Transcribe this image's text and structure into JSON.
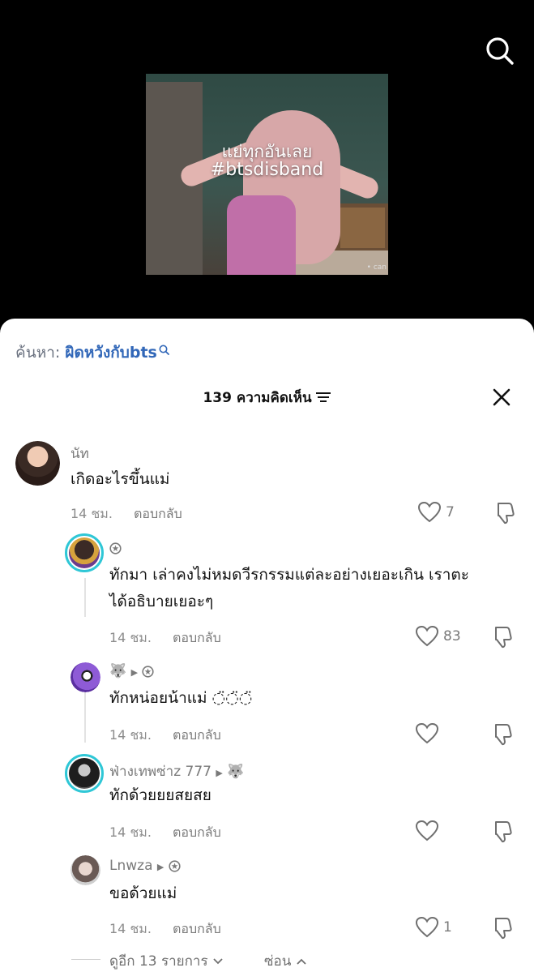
{
  "video": {
    "caption_line1": "แย่ทุกอันเลย",
    "caption_line2": "#btsdisband",
    "watermark": "• can"
  },
  "search_suggestion": {
    "prefix": "ค้นหา:",
    "query": "ผิดหวังกับbts"
  },
  "comments_header": {
    "title": "139 ความคิดเห็น"
  },
  "comments": [
    {
      "username": "นัท",
      "text": "เกิดอะไรขึ้นแม่",
      "time": "14 ชม.",
      "reply_label": "ตอบกลับ",
      "likes": "7"
    },
    {
      "username": "",
      "text_line1": "ทักมา เล่าคงไม่หมดวีรกรรมแต่ละอย่างเยอะเกิน เราตะ",
      "text_line2": "ได้อธิบายเยอะๆ",
      "time": "14 ชม.",
      "reply_label": "ตอบกลับ",
      "likes": "83"
    },
    {
      "username": "",
      "text": "ทักหน่อยน้าแม่ ◌̈◌̈◌̈",
      "time": "14 ชม.",
      "reply_label": "ตอบกลับ",
      "likes": ""
    },
    {
      "username": "ฟ่างเทพซ่าz 777",
      "text": "ทักด้วยยยสยสย",
      "time": "14 ชม.",
      "reply_label": "ตอบกลับ",
      "likes": ""
    },
    {
      "username": "Lnwza",
      "text": "ขอด้วยแม่",
      "time": "14 ชม.",
      "reply_label": "ตอบกลับ",
      "likes": "1"
    }
  ],
  "footer": {
    "view_more": "ดูอีก 13 รายการ",
    "hide": "ซ่อน"
  },
  "colors": {
    "accent_link": "#3167b8",
    "ring": "#2fc7d6",
    "muted_text": "#8c8c8c"
  },
  "icons": [
    "search-icon",
    "filter-icon",
    "close-icon",
    "heart-icon",
    "dislike-icon",
    "verified-icon",
    "wolf-icon",
    "chevron-down-icon",
    "chevron-up-icon"
  ]
}
